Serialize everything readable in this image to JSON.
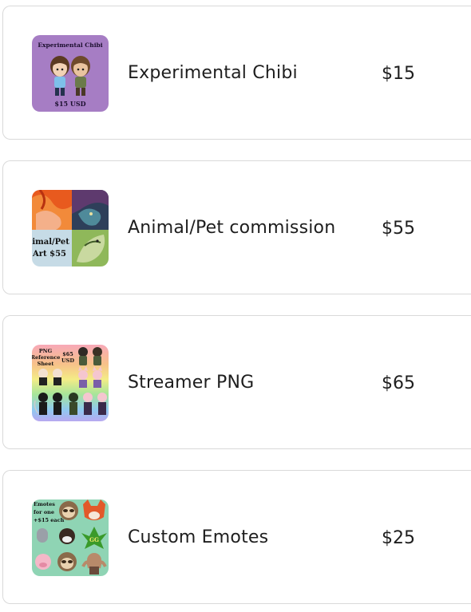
{
  "products": [
    {
      "title": "Experimental Chibi",
      "price": "$15",
      "thumb_text": {
        "top": "Experimental Chibi",
        "bottom": "$15 USD"
      }
    },
    {
      "title": "Animal/Pet commission",
      "price": "$55",
      "thumb_text": {
        "line1": "nimal/Pet",
        "line2": "Art $55"
      }
    },
    {
      "title": "Streamer PNG",
      "price": "$65",
      "thumb_text": {
        "line1": "PNG",
        "line2": "Reference",
        "line3": "Sheet",
        "price1": "$65",
        "price2": "USD"
      }
    },
    {
      "title": "Custom Emotes",
      "price": "$25",
      "thumb_text": {
        "line1": "Emotes",
        "line2": "for one",
        "line3": "+$15 each"
      }
    }
  ],
  "colors": {
    "border": "#d9d9d9",
    "text": "#1e1e1e",
    "chibi_bg": "#a67dc4"
  }
}
